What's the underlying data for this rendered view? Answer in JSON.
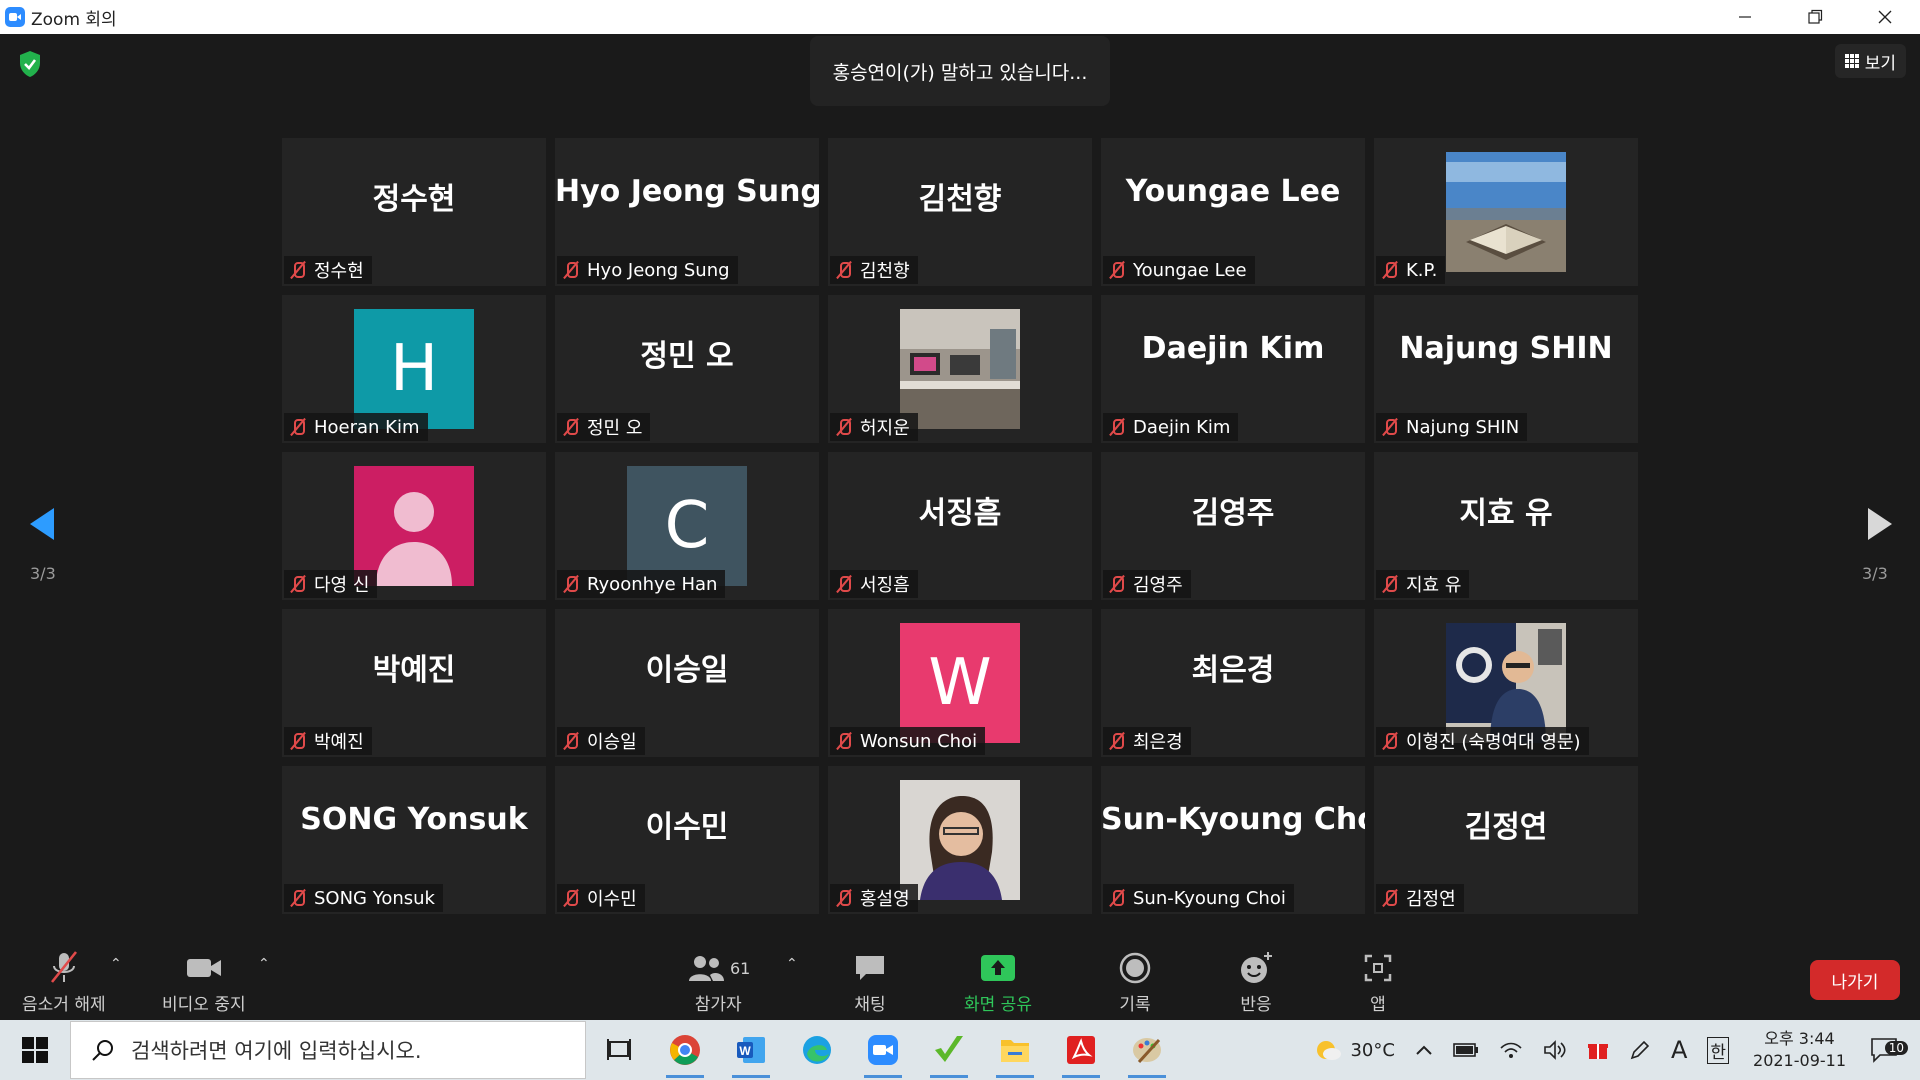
{
  "window": {
    "title": "Zoom 회의"
  },
  "banner": {
    "speaking": "홍승연이(가) 말하고 있습니다..."
  },
  "view": {
    "label": "보기"
  },
  "pagination": {
    "left": "3/3",
    "right": "3/3"
  },
  "participants": [
    {
      "big": "정수현",
      "label": "정수현"
    },
    {
      "big": "Hyo Jeong Sung",
      "label": "Hyo Jeong Sung"
    },
    {
      "big": "김천향",
      "label": "김천향"
    },
    {
      "big": "Youngae Lee",
      "label": "Youngae Lee"
    },
    {
      "big": "",
      "label": "K.P.",
      "photo": "seaside-book-photo"
    },
    {
      "big": "",
      "label": "Hoeran Kim",
      "avatar": "H",
      "color": "#0e9aa7"
    },
    {
      "big": "정민 오",
      "label": "정민 오"
    },
    {
      "big": "",
      "label": "허지운",
      "photo": "room-photo"
    },
    {
      "big": "Daejin Kim",
      "label": "Daejin Kim"
    },
    {
      "big": "Najung SHIN",
      "label": "Najung SHIN"
    },
    {
      "big": "",
      "label": "다영 신",
      "avatar": "person",
      "color": "#cc1e63"
    },
    {
      "big": "",
      "label": "Ryoonhye Han",
      "avatar": "C",
      "color": "#3f5460"
    },
    {
      "big": "서징흠",
      "label": "서징흠"
    },
    {
      "big": "김영주",
      "label": "김영주"
    },
    {
      "big": "지효 유",
      "label": "지효 유"
    },
    {
      "big": "박예진",
      "label": "박예진"
    },
    {
      "big": "이승일",
      "label": "이승일"
    },
    {
      "big": "",
      "label": "Wonsun Choi",
      "avatar": "W",
      "color": "#e83a6e"
    },
    {
      "big": "최은경",
      "label": "최은경"
    },
    {
      "big": "",
      "label": "이형진 (숙명여대 영문)",
      "photo": "man-photo"
    },
    {
      "big": "SONG Yonsuk",
      "label": "SONG Yonsuk"
    },
    {
      "big": "이수민",
      "label": "이수민"
    },
    {
      "big": "",
      "label": "홍설영",
      "photo": "woman-photo"
    },
    {
      "big": "Sun-Kyoung Choi",
      "label": "Sun-Kyoung Choi"
    },
    {
      "big": "김정연",
      "label": "김정연"
    }
  ],
  "toolbar": {
    "unmute": "음소거 해제",
    "stop_video": "비디오 중지",
    "participants": "참가자",
    "participant_count": "61",
    "chat": "채팅",
    "share": "화면 공유",
    "record": "기록",
    "reactions": "반응",
    "apps": "앱",
    "leave": "나가기"
  },
  "taskbar": {
    "search_placeholder": "검색하려면 여기에 입력하십시오.",
    "weather": "30°C",
    "ime_a": "A",
    "ime_han": "한",
    "time": "오후 3:44",
    "date": "2021-09-11",
    "notifications": "10"
  },
  "colors": {
    "share_green": "#2fc65a",
    "leave_red": "#d32a2a",
    "muted_red": "#e04a4a"
  }
}
